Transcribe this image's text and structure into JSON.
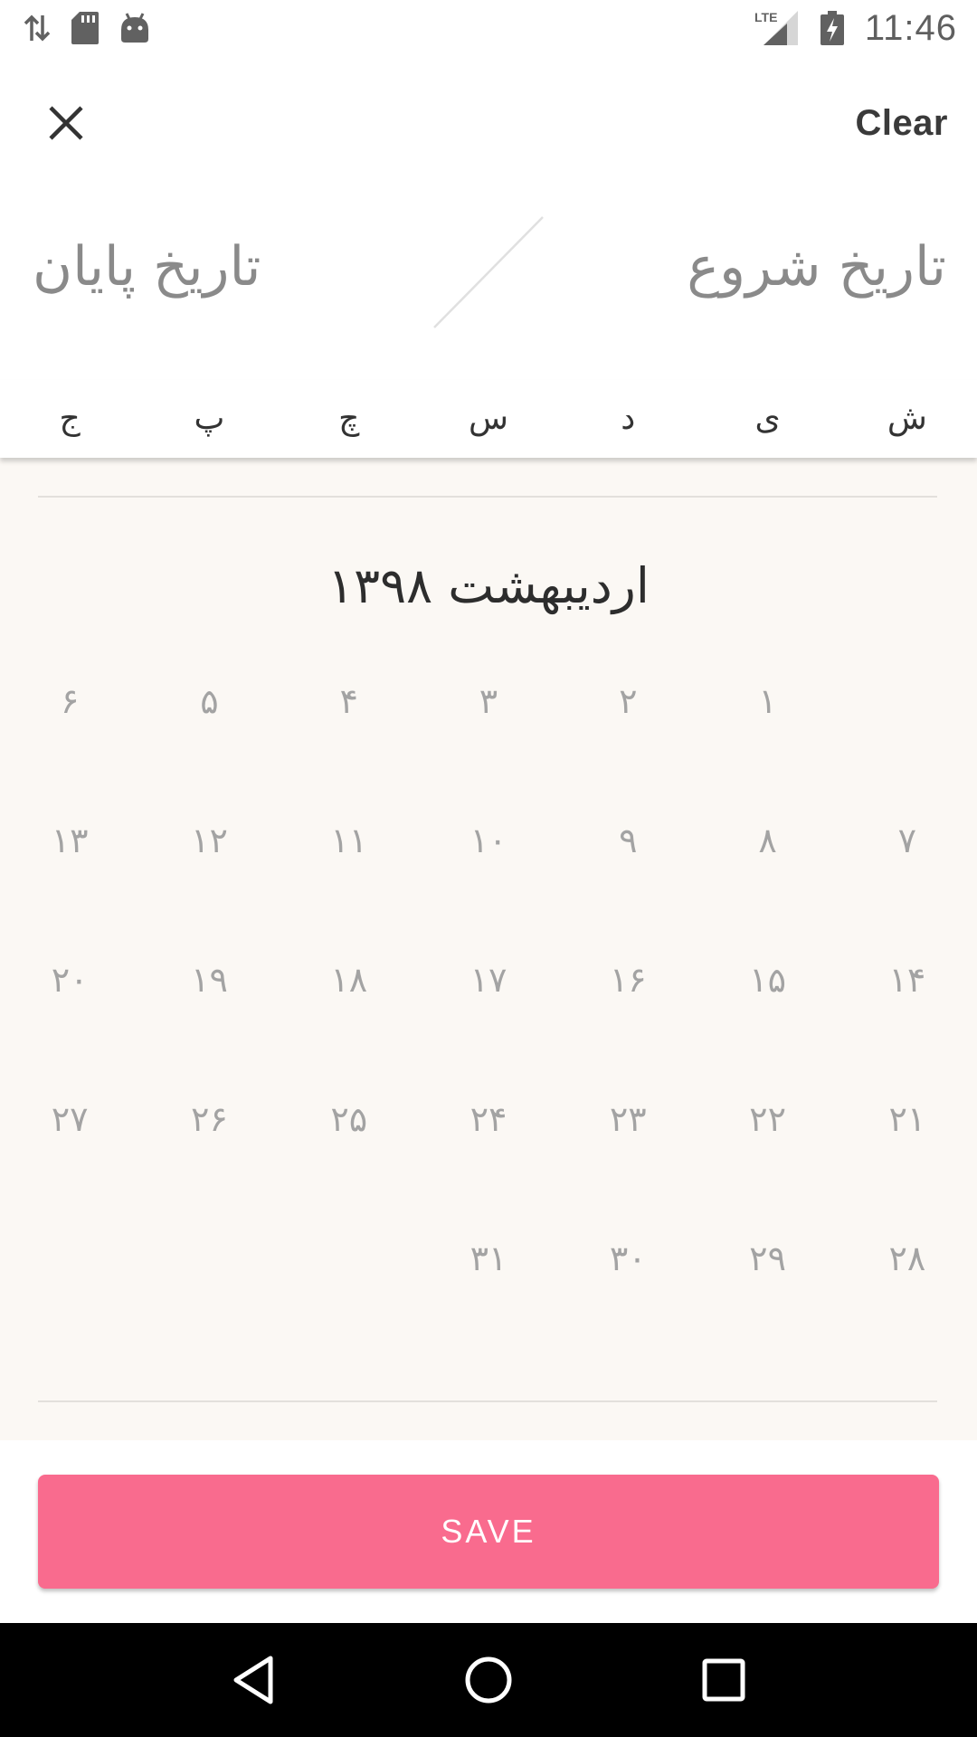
{
  "status_bar": {
    "time": "11:46",
    "network_label": "LTE",
    "icons": [
      "data-transfer-icon",
      "sd-card-icon",
      "android-icon",
      "lte-signal-icon",
      "battery-charging-icon"
    ]
  },
  "toolbar": {
    "close_icon": "close-icon",
    "clear_label": "Clear"
  },
  "range": {
    "start_label": "تاریخ شروع",
    "end_label": "تاریخ پایان"
  },
  "weekdays": [
    "ش",
    "ی",
    "د",
    "س",
    "چ",
    "پ",
    "ج"
  ],
  "month": {
    "title": "اردیبهشت ۱۳۹۸",
    "days": [
      "",
      "۱",
      "۲",
      "۳",
      "۴",
      "۵",
      "۶",
      "۷",
      "۸",
      "۹",
      "۱۰",
      "۱۱",
      "۱۲",
      "۱۳",
      "۱۴",
      "۱۵",
      "۱۶",
      "۱۷",
      "۱۸",
      "۱۹",
      "۲۰",
      "۲۱",
      "۲۲",
      "۲۳",
      "۲۴",
      "۲۵",
      "۲۶",
      "۲۷",
      "۲۸",
      "۲۹",
      "۳۰",
      "۳۱"
    ]
  },
  "save": {
    "label": "SAVE"
  },
  "colors": {
    "accent": "#f96b8e",
    "calendar_background": "#fbf8f4",
    "day_text": "#a3a3a3"
  },
  "nav_bar": {
    "icons": [
      "back-icon",
      "home-icon",
      "recents-icon"
    ]
  }
}
